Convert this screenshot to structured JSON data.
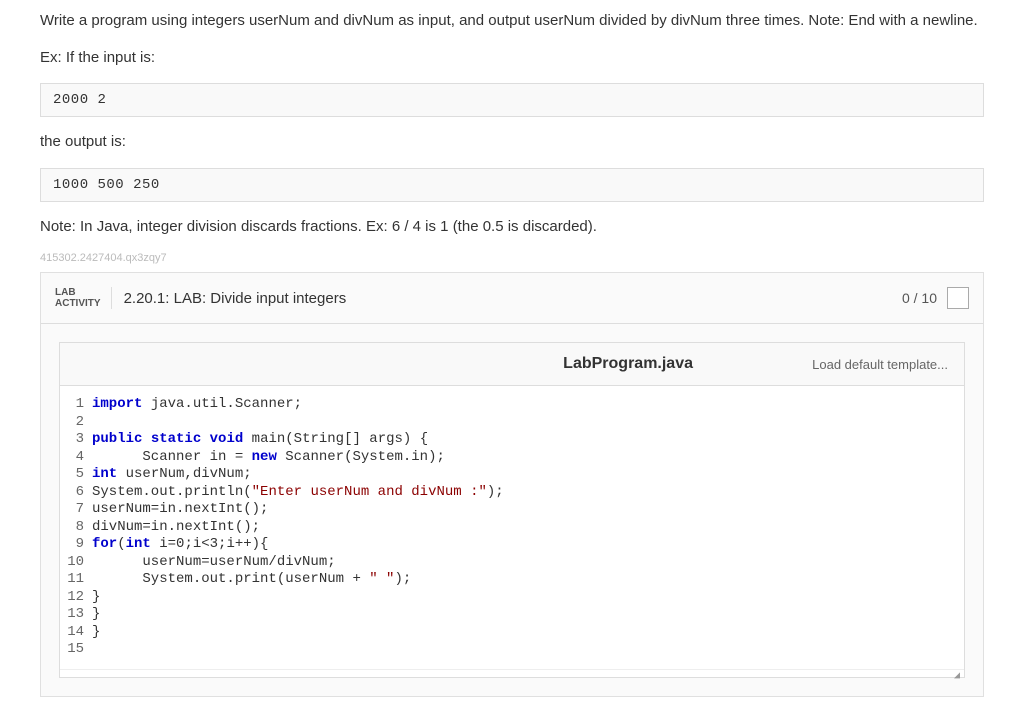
{
  "instructions": {
    "p1": "Write a program using integers userNum and divNum as input, and output userNum divided by divNum three times. Note: End with a newline.",
    "p2": "Ex: If the input is:",
    "input_example": "2000 2",
    "p3": "the output is:",
    "output_example": "1000 500 250",
    "p4": "Note: In Java, integer division discards fractions. Ex: 6 / 4 is 1 (the 0.5 is discarded).",
    "watermark": "415302.2427404.qx3zqy7"
  },
  "lab": {
    "tag_line1": "LAB",
    "tag_line2": "ACTIVITY",
    "title": "2.20.1: LAB: Divide input integers",
    "score": "0 / 10"
  },
  "editor": {
    "filename": "LabProgram.java",
    "load_template": "Load default template...",
    "lines": [
      {
        "n": "1",
        "plain": "import java.util.Scanner;"
      },
      {
        "n": "2",
        "plain": ""
      },
      {
        "n": "3",
        "plain": "public static void main(String[] args) {"
      },
      {
        "n": "4",
        "plain": "      Scanner in = new Scanner(System.in);"
      },
      {
        "n": "5",
        "plain": "int userNum,divNum;"
      },
      {
        "n": "6",
        "plain": "System.out.println(\"Enter userNum and divNum :\");"
      },
      {
        "n": "7",
        "plain": "userNum=in.nextInt();"
      },
      {
        "n": "8",
        "plain": "divNum=in.nextInt();"
      },
      {
        "n": "9",
        "plain": "for(int i=0;i<3;i++){"
      },
      {
        "n": "10",
        "plain": "      userNum=userNum/divNum;"
      },
      {
        "n": "11",
        "plain": "      System.out.print(userNum + \" \");"
      },
      {
        "n": "12",
        "plain": "}"
      },
      {
        "n": "13",
        "plain": "}"
      },
      {
        "n": "14",
        "plain": "}"
      },
      {
        "n": "15",
        "plain": ""
      }
    ]
  }
}
